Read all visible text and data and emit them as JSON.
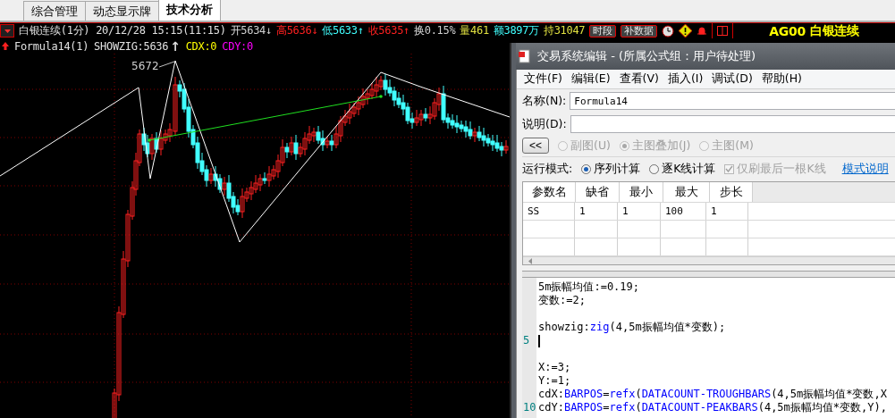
{
  "tabs": [
    {
      "label": "综合管理",
      "selected": false
    },
    {
      "label": "动态显示牌",
      "selected": false
    },
    {
      "label": "技术分析",
      "selected": true
    }
  ],
  "quote_bar": {
    "title": "白银连续(1分) 20/12/28 15:15(11:15)",
    "fields": [
      {
        "label": "开",
        "value": "5634",
        "arrow": "↓",
        "color": "#d0d0d0"
      },
      {
        "label": "高",
        "value": "5636",
        "arrow": "↓",
        "color": "#ff2020"
      },
      {
        "label": "低",
        "value": "5633",
        "arrow": "↑",
        "color": "#40ffff"
      },
      {
        "label": "收",
        "value": "5635",
        "arrow": "↑",
        "color": "#ff2020"
      },
      {
        "label": "换",
        "value": "0.15%",
        "color": "#d0d0d0"
      },
      {
        "label": "量",
        "value": "461",
        "color": "#e0e040"
      },
      {
        "label": "额",
        "value": "3897万",
        "color": "#40ffff"
      },
      {
        "label": "持",
        "value": "31047",
        "color": "#e0e040"
      }
    ],
    "buttons": [
      "时段",
      "补数据"
    ],
    "symbol_code": "AG00",
    "symbol_name": "白银连续"
  },
  "formula_bar": {
    "name": "Formula14(1)",
    "values": [
      {
        "text": "SHOWZIG:5636",
        "color": "#e0e0e0"
      },
      {
        "text": "↑",
        "color": "#e0e0e0"
      },
      {
        "text": "CDX:0",
        "color": "#ffff00"
      },
      {
        "text": "CDY:0",
        "color": "#ff00ff"
      }
    ]
  },
  "chart": {
    "peak_label": "5672"
  },
  "dialog": {
    "title": "交易系统编辑 - (所属公式组：用户待处理)",
    "menu": [
      "文件(F)",
      "编辑(E)",
      "查看(V)",
      "插入(I)",
      "调试(D)",
      "帮助(H)"
    ],
    "name_label": "名称(N):",
    "name_value": "Formula14",
    "desc_label": "说明(D):",
    "collapse_button": "<<",
    "chart_types": [
      {
        "label": "副图(U)",
        "selected": false,
        "disabled": true
      },
      {
        "label": "主图叠加(J)",
        "selected": true,
        "disabled": true
      },
      {
        "label": "主图(M)",
        "selected": false,
        "disabled": true
      }
    ],
    "run_mode_label": "运行模式:",
    "run_modes": [
      {
        "label": "序列计算",
        "selected": true
      },
      {
        "label": "逐K线计算",
        "selected": false
      }
    ],
    "refresh_last": {
      "label": "仅刷最后一根K线",
      "checked": true,
      "disabled": true
    },
    "mode_help_link": "模式说明",
    "params": {
      "columns": [
        "参数名",
        "缺省",
        "最小",
        "最大",
        "步长"
      ],
      "rows": [
        [
          "SS",
          "1",
          "1",
          "100",
          "1"
        ]
      ]
    },
    "code": [
      {
        "segments": [
          {
            "kind": "text",
            "text": "5m振幅均值:=0.19;"
          }
        ]
      },
      {
        "segments": [
          {
            "kind": "text",
            "text": "变数:=2;"
          }
        ]
      },
      {
        "cursor": false
      },
      {
        "segments": [
          {
            "kind": "text",
            "text": "showzig:"
          },
          {
            "kind": "keyword",
            "text": "zig"
          },
          {
            "kind": "text",
            "text": "(4,5m振幅均值*变数);"
          }
        ]
      },
      {
        "number": "5",
        "cursor": true
      },
      {
        "cursor": false
      },
      {
        "segments": [
          {
            "kind": "text",
            "text": "X:=3;"
          }
        ]
      },
      {
        "segments": [
          {
            "kind": "text",
            "text": "Y:=1;"
          }
        ]
      },
      {
        "segments": [
          {
            "kind": "text",
            "text": "cdX:"
          },
          {
            "kind": "keyword",
            "text": "BARPOS"
          },
          {
            "kind": "text",
            "text": "="
          },
          {
            "kind": "keyword",
            "text": "refx"
          },
          {
            "kind": "text",
            "text": "("
          },
          {
            "kind": "keyword",
            "text": "DATACOUNT-TROUGHBARS"
          },
          {
            "kind": "text",
            "text": "(4,5m振幅均值*变数,X"
          }
        ]
      },
      {
        "number": "10",
        "segments": [
          {
            "kind": "text",
            "text": "cdY:"
          },
          {
            "kind": "keyword",
            "text": "BARPOS"
          },
          {
            "kind": "text",
            "text": "="
          },
          {
            "kind": "keyword",
            "text": "refx"
          },
          {
            "kind": "text",
            "text": "("
          },
          {
            "kind": "keyword",
            "text": "DATACOUNT-PEAKBARS"
          },
          {
            "kind": "text",
            "text": "(4,5m振幅均值*变数,Y),"
          }
        ]
      }
    ]
  }
}
